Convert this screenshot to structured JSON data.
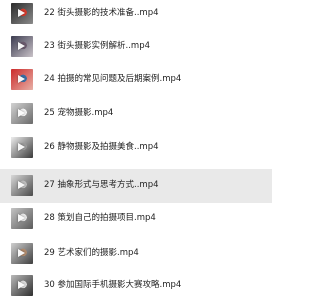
{
  "files": [
    {
      "name": "22 街头摄影的技术准备..mp4",
      "thumb_colors": [
        "#2b2b2b",
        "#8a8a8a",
        "#d33a2c"
      ]
    },
    {
      "name": "23 街头摄影实例解析..mp4",
      "thumb_colors": [
        "#3b3b4f",
        "#c9c2c8",
        "#6b5b6e"
      ]
    },
    {
      "name": "24 拍摄的常见问题及后期案例.mp4",
      "thumb_colors": [
        "#cc2a2a",
        "#e7b0a6",
        "#3a6fa5"
      ]
    },
    {
      "name": "25 宠物摄影.mp4",
      "thumb_colors": [
        "#d2d2d2",
        "#6a6a6a",
        "#f2f2f2"
      ]
    },
    {
      "name": "26 静物摄影及拍摄美食..mp4",
      "thumb_colors": [
        "#eeeeee",
        "#3a3a3a",
        "#9a9a9a"
      ]
    },
    {
      "name": "27 抽象形式与思考方式..mp4",
      "thumb_colors": [
        "#d8d8d8",
        "#4a4a4a",
        "#bdbdbd"
      ]
    },
    {
      "name": "28 策划自己的拍摄项目.mp4",
      "thumb_colors": [
        "#c4c4c4",
        "#5b5b5b",
        "#e6e6e6"
      ]
    },
    {
      "name": "29 艺术家们的摄影.mp4",
      "thumb_colors": [
        "#cfcfcf",
        "#3f3f3f",
        "#b08a6c"
      ]
    },
    {
      "name": "30 参加国际手机摄影大赛攻略.mp4",
      "thumb_colors": [
        "#b9b9b9",
        "#2e2e2e",
        "#d9d9d9"
      ]
    }
  ],
  "highlighted_index": 5,
  "icons": {
    "play": "play-icon",
    "thumbnail": "video-thumbnail"
  }
}
